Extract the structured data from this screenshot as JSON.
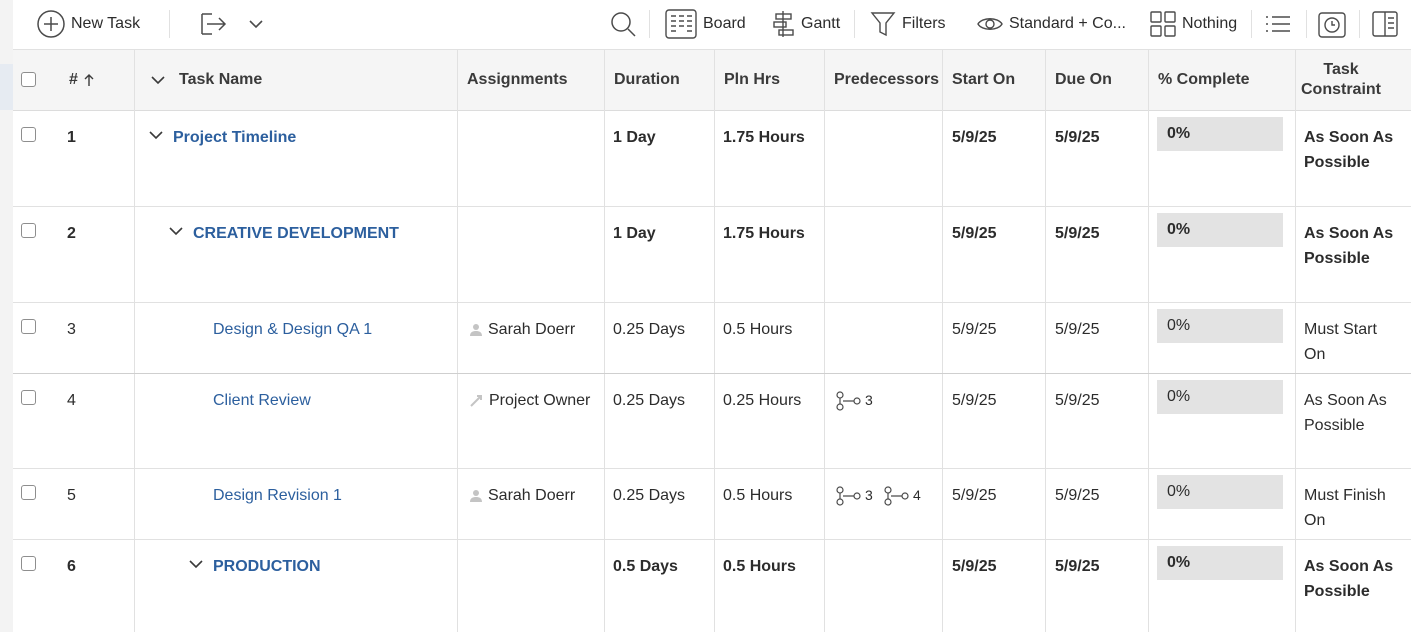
{
  "toolbar": {
    "new_task": "New Task",
    "board": "Board",
    "gantt": "Gantt",
    "filters": "Filters",
    "view": "Standard + Co...",
    "grouping": "Nothing"
  },
  "columns": {
    "num": "#",
    "task_name": "Task Name",
    "assignments": "Assignments",
    "duration": "Duration",
    "pln_hrs": "Pln Hrs",
    "predecessors": "Predecessors",
    "start_on": "Start On",
    "due_on": "Due On",
    "pct_complete": "% Complete",
    "task_constraint": "Task Constraint"
  },
  "rows": [
    {
      "num": "1",
      "name": "Project Timeline",
      "assignment": "",
      "duration": "1 Day",
      "pln_hrs": "1.75 Hours",
      "predecessors": [],
      "start": "5/9/25",
      "due": "5/9/25",
      "pct": "0%",
      "constraint": "As Soon As Possible"
    },
    {
      "num": "2",
      "name": "CREATIVE DEVELOPMENT",
      "assignment": "",
      "duration": "1 Day",
      "pln_hrs": "1.75 Hours",
      "predecessors": [],
      "start": "5/9/25",
      "due": "5/9/25",
      "pct": "0%",
      "constraint": "As Soon As Possible"
    },
    {
      "num": "3",
      "name": "Design & Design QA 1",
      "assignment": "Sarah Doerr",
      "duration": "0.25 Days",
      "pln_hrs": "0.5 Hours",
      "predecessors": [],
      "start": "5/9/25",
      "due": "5/9/25",
      "pct": "0%",
      "constraint": "Must Start On"
    },
    {
      "num": "4",
      "name": "Client Review",
      "assignment": "Project Owner",
      "duration": "0.25 Days",
      "pln_hrs": "0.25 Hours",
      "predecessors": [
        "3"
      ],
      "start": "5/9/25",
      "due": "5/9/25",
      "pct": "0%",
      "constraint": "As Soon As Possible"
    },
    {
      "num": "5",
      "name": "Design Revision 1",
      "assignment": "Sarah Doerr",
      "duration": "0.25 Days",
      "pln_hrs": "0.5 Hours",
      "predecessors": [
        "3",
        "4"
      ],
      "start": "5/9/25",
      "due": "5/9/25",
      "pct": "0%",
      "constraint": "Must Finish On"
    },
    {
      "num": "6",
      "name": "PRODUCTION",
      "assignment": "",
      "duration": "0.5 Days",
      "pln_hrs": "0.5 Hours",
      "predecessors": [],
      "start": "5/9/25",
      "due": "5/9/25",
      "pct": "0%",
      "constraint": "As Soon As Possible"
    }
  ]
}
